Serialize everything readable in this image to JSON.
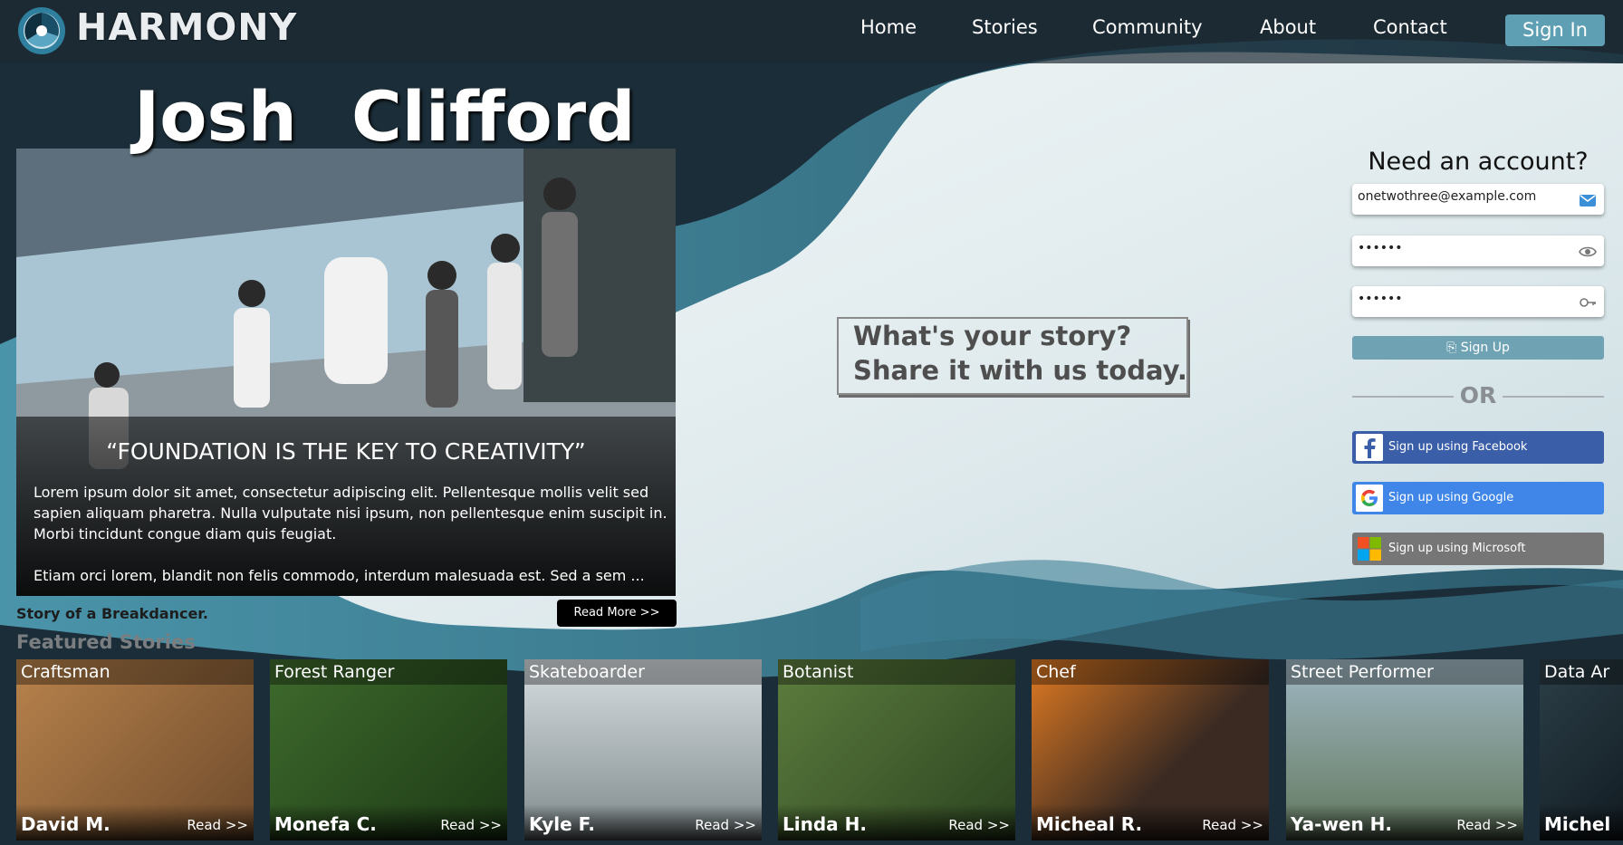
{
  "brand": {
    "name": "HARMONY",
    "logo_icon": "harmony-logo-icon"
  },
  "nav": {
    "items": [
      "Home",
      "Stories",
      "Community",
      "About",
      "Contact"
    ],
    "signin_label": "Sign In"
  },
  "hero": {
    "first_name": "Josh",
    "last_name": "Clifford",
    "quote": "“FOUNDATION IS THE KEY TO CREATIVITY”",
    "paragraph1": "Lorem ipsum dolor sit amet, consectetur adipiscing elit. Pellentesque mollis velit sed sapien aliquam pharetra. Nulla vulputate nisi ipsum, non pellentesque enim suscipit in. Morbi tincidunt congue diam quis feugiat.",
    "paragraph2": "Etiam orci lorem, blandit non felis commodo, interdum malesuada est. Sed a sem ...",
    "subtitle": "Story of a Breakdancer.",
    "read_more": "Read More >>"
  },
  "tagline": {
    "line1": "What's your story?",
    "line2": "Share it with us today."
  },
  "signup": {
    "heading": "Need an account?",
    "email_value": "onetwothree@example.com",
    "password_value": "••••••",
    "confirm_value": "••••••",
    "email_icon": "envelope-icon",
    "password_icon": "eye-icon",
    "confirm_icon": "key-icon",
    "submit_label": "Sign Up",
    "submit_icon": "signup-icon",
    "or_label": "OR",
    "facebook_label": "Sign up using Facebook",
    "google_label": "Sign up using Google",
    "microsoft_label": "Sign up using Microsoft"
  },
  "colors": {
    "accent": "#5f9fb3",
    "facebook": "#3a5ea8",
    "google": "#3f86e8",
    "microsoft": "#767676",
    "dark_wave": "#1c2f3b"
  },
  "featured": {
    "title": "Featured Stories",
    "read_label": "Read >>",
    "cards": [
      {
        "role": "Craftsman",
        "name": "David M."
      },
      {
        "role": "Forest Ranger",
        "name": "Monefa C."
      },
      {
        "role": "Skateboarder",
        "name": "Kyle F."
      },
      {
        "role": "Botanist",
        "name": "Linda H."
      },
      {
        "role": "Chef",
        "name": "Micheal R."
      },
      {
        "role": "Street Performer",
        "name": "Ya-wen H."
      },
      {
        "role": "Data Ar",
        "name": "Michel"
      }
    ]
  }
}
